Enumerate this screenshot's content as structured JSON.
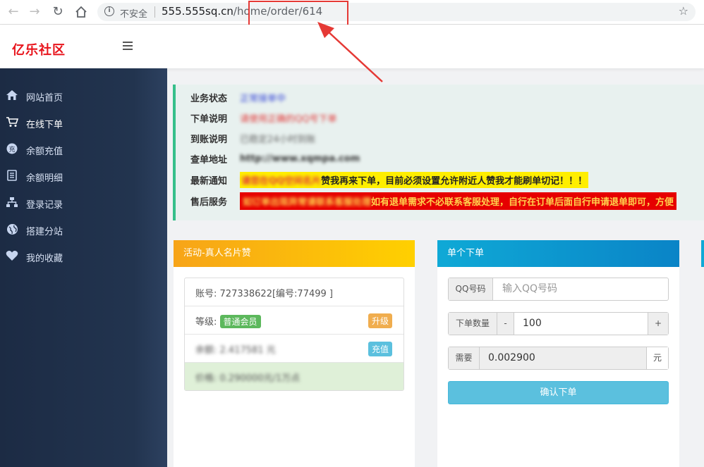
{
  "browser": {
    "security_label": "不安全",
    "url_host": "555.555sq.cn",
    "url_path": "/home/order/614"
  },
  "site": {
    "brand": "亿乐社区"
  },
  "sidebar": {
    "items": [
      {
        "label": "网站首页",
        "icon": "home-icon"
      },
      {
        "label": "在线下单",
        "icon": "cart-icon"
      },
      {
        "label": "余额充值",
        "icon": "recharge-icon"
      },
      {
        "label": "余额明细",
        "icon": "ledger-icon"
      },
      {
        "label": "登录记录",
        "icon": "sitemap-icon"
      },
      {
        "label": "搭建分站",
        "icon": "globe-icon"
      },
      {
        "label": "我的收藏",
        "icon": "heart-icon"
      }
    ]
  },
  "notice": {
    "rows": [
      {
        "label": "业务状态",
        "value": "正常接单中"
      },
      {
        "label": "下单说明",
        "value": "请使用正确的QQ号下单"
      },
      {
        "label": "到账说明",
        "value": "已稳定24小时到账"
      },
      {
        "label": "查单地址",
        "value": "http://www.xqmpa.com"
      },
      {
        "label": "最新通知",
        "value_hidden": "请您在QQ空间名片",
        "value_visible": "赞我再来下单，目前必须设置允许附近人赞我才能刷单切记！！！"
      },
      {
        "label": "售后服务",
        "value_hidden": "如订单出现异常请联系客服处理",
        "value_visible": "如有退单需求不必联系客服处理，自行在订单后面自行申请退单即可，方便"
      }
    ]
  },
  "activity_card": {
    "title": "活动-真人名片赞",
    "account_label": "账号:",
    "account_value": "727338622[编号:77499 ]",
    "level_label": "等级:",
    "level_badge": "普通会员",
    "upgrade_button": "升级",
    "balance_label": "余额:",
    "balance_value": "2.417581 元",
    "recharge_button": "充值",
    "price_label": "价格:",
    "price_value": "0.290000元/1万点"
  },
  "single_order_card": {
    "title": "单个下单",
    "qq_label": "QQ号码",
    "qq_placeholder": "输入QQ号码",
    "qty_label": "下单数量",
    "qty_minus": "-",
    "qty_value": "100",
    "qty_plus": "+",
    "need_label": "需要",
    "need_value": "0.002900",
    "need_unit": "元",
    "confirm_button": "确认下单"
  },
  "colors": {
    "brand_red": "#e8131b",
    "sidebar_bg": "#1c2b44",
    "activity_orange": "#f7a418",
    "single_blue": "#0a84c7",
    "confirm_button": "#5bc0de",
    "annotation_red": "#e53935"
  }
}
